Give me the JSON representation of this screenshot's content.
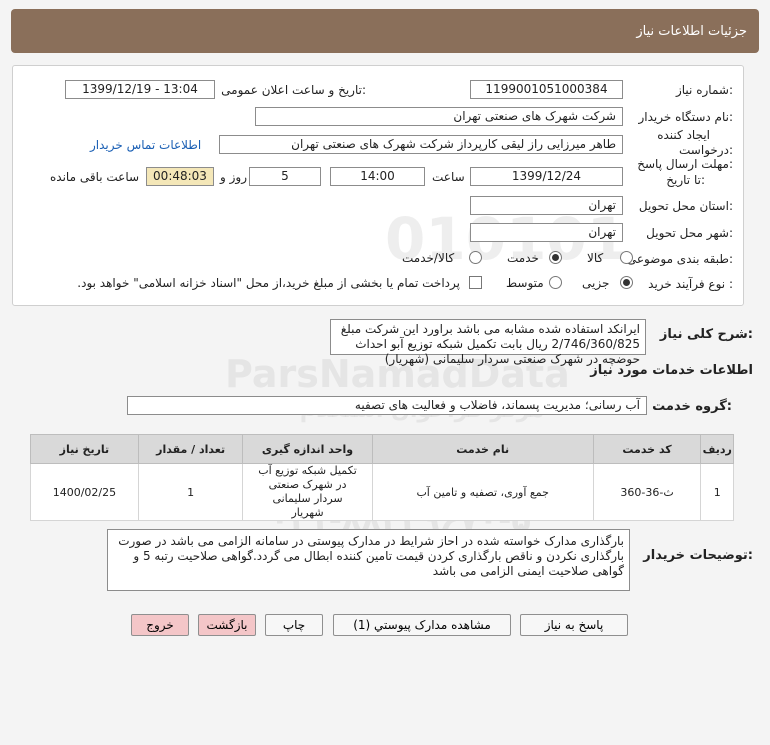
{
  "header": {
    "title": "جزئیات اطلاعات نیاز"
  },
  "fields": {
    "need_number_label": "شماره نیاز:",
    "need_number": "1199001051000384",
    "announce_label": "تاریخ و ساعت اعلان عمومی:",
    "announce_value": "1399/12/19 - 13:04",
    "buyer_org_label": "نام دستگاه خریدار:",
    "buyer_org": "شرکت شهرک های صنعتی تهران",
    "creator_label_1": "ایجاد کننده",
    "creator_label_2": "درخواست:",
    "creator": "طاهر  میرزایی راز لیقی کارپرداز  شرکت شهرک های صنعتی تهران",
    "contact_link": "اطلاعات تماس خریدار",
    "deadline_label_1": "مهلت ارسال پاسخ:",
    "deadline_label_2": "تا تاریخ:",
    "deadline_date": "1399/12/24",
    "time_label": "ساعت",
    "deadline_time": "14:00",
    "days_value": "5",
    "days_label": "روز و",
    "remaining_time": "00:48:03",
    "remaining_label": "ساعت باقی مانده",
    "province_label": "استان محل تحویل:",
    "province": "تهران",
    "city_label": "شهر محل تحویل:",
    "city": "تهران",
    "category_label": "طبقه بندی موضوعی:",
    "category_options": [
      "کالا",
      "خدمت",
      "کالا/خدمت"
    ],
    "process_label": "نوع فرآیند خرید :",
    "process_options": [
      "جزیی",
      "متوسط"
    ],
    "payment_note": "پرداخت تمام یا بخشی از مبلغ خرید،از محل \"اسناد خزانه اسلامی\" خواهد بود."
  },
  "summary": {
    "label": "شرح کلی نیاز:",
    "text": "ایرانکد استفاده شده مشابه می باشد براورد این شرکت مبلغ 2/746/360/825 ریال بابت تکمیل شبکه توزیع آبو احداث حوضچه  در شهرک صنعتی سردار سلیمانی (شهریار)"
  },
  "services_title": "اطلاعات خدمات مورد نیاز",
  "service_group": {
    "label": "گروه خدمت:",
    "value": "آب رسانی؛ مدیریت پسماند، فاضلاب و فعالیت های تصفیه"
  },
  "table": {
    "headers": [
      "ردیف",
      "کد خدمت",
      "نام خدمت",
      "واحد اندازه گیری",
      "تعداد / مقدار",
      "تاریخ نیاز"
    ],
    "rows": [
      [
        "1",
        "ث-36-360",
        "جمع آوری، تصفیه و تامین آب",
        "تکمیل شبکه توزیع آب در شهرک صنعتی سردار سلیمانی شهریار",
        "1",
        "1400/02/25"
      ]
    ]
  },
  "buyer_notes": {
    "label": "توضیحات خریدار:",
    "text": "بارگذاری مدارک خواسته شده در احاز شرایط در مدارک پیوستی در سامانه الزامی می باشد در صورت بارگذاری نکردن و ناقص بارگذاری کردن قیمت تامین کننده ابطال می گردد.گواهی صلاحیت رتبه 5 و گواهی صلاحیت ایمنی الزامی می باشد"
  },
  "buttons": {
    "reply": "پاسخ به نیاز",
    "attachments": "مشاهده مدارک پیوستي (1)",
    "print": "چاپ",
    "back": "بازگشت",
    "exit": "خروج"
  },
  "watermark": {
    "code": "010101",
    "site": "ParsNamadData",
    "center": "مرکز فراخوان استعلام",
    "portal": "پایگاه اطلاع رسانی مناقصات ایران",
    "phone": "۰۲۱-۸۸۳۴۹۶۷۰-۵"
  }
}
